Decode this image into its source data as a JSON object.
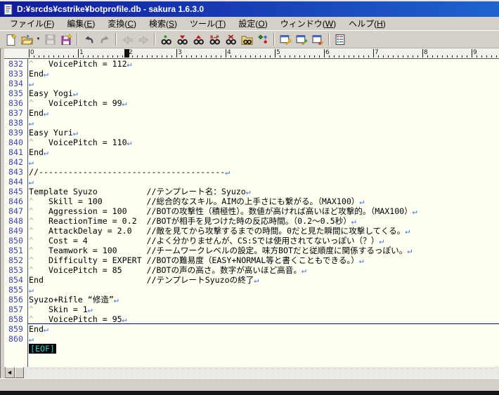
{
  "window": {
    "title": "D:¥srcds¥cstrike¥botprofile.db - sakura 1.6.3.0",
    "app_icon": "sakura-document-icon"
  },
  "menu": {
    "items": [
      {
        "label": "ファイル",
        "key": "F"
      },
      {
        "label": "編集",
        "key": "E"
      },
      {
        "label": "変換",
        "key": "C"
      },
      {
        "label": "検索",
        "key": "S"
      },
      {
        "label": "ツール",
        "key": "T"
      },
      {
        "label": "設定",
        "key": "O"
      },
      {
        "label": "ウィンドウ",
        "key": "W"
      },
      {
        "label": "ヘルプ",
        "key": "H"
      }
    ]
  },
  "toolbar": {
    "buttons": [
      {
        "name": "new-file",
        "icon": "new-file-icon",
        "enabled": true
      },
      {
        "name": "open-file",
        "icon": "open-folder-icon",
        "enabled": true,
        "dropdown": true
      },
      {
        "name": "save",
        "icon": "save-floppy-icon",
        "enabled": false
      },
      {
        "name": "save-as",
        "icon": "save-as-floppy-icon",
        "enabled": true
      },
      {
        "sep": true
      },
      {
        "name": "undo",
        "icon": "undo-arrow-icon",
        "enabled": true
      },
      {
        "name": "redo",
        "icon": "redo-arrow-icon",
        "enabled": false
      },
      {
        "sep": true
      },
      {
        "name": "jump-back",
        "icon": "jump-back-icon",
        "enabled": false
      },
      {
        "name": "jump-forward",
        "icon": "jump-forward-icon",
        "enabled": false
      },
      {
        "sep": true
      },
      {
        "name": "find",
        "icon": "find-binoculars-icon",
        "enabled": true
      },
      {
        "name": "find-next",
        "icon": "find-next-icon",
        "enabled": true
      },
      {
        "name": "find-prev",
        "icon": "find-prev-icon",
        "enabled": true
      },
      {
        "name": "replace",
        "icon": "replace-icon",
        "enabled": true
      },
      {
        "name": "clear-search",
        "icon": "clear-search-icon",
        "enabled": true
      },
      {
        "name": "grep",
        "icon": "grep-folder-icon",
        "enabled": true
      },
      {
        "name": "tag-jump",
        "icon": "tag-jump-icon",
        "enabled": true
      },
      {
        "sep": true
      },
      {
        "name": "type-settings",
        "icon": "type-settings-icon",
        "enabled": true
      },
      {
        "name": "common-settings",
        "icon": "common-settings-icon",
        "enabled": true
      },
      {
        "name": "keyword-settings",
        "icon": "keyword-settings-icon",
        "enabled": true
      },
      {
        "sep": true
      },
      {
        "name": "outline",
        "icon": "outline-icon",
        "enabled": true
      }
    ]
  },
  "ruler": {
    "cursor_col": 20,
    "columns_per_number": 10,
    "numbers": [
      "0",
      "1",
      "2",
      "3",
      "4",
      "5",
      "6",
      "7",
      "8",
      "9"
    ]
  },
  "editor": {
    "current_line": 858,
    "eof_label": "[EOF]",
    "lines": [
      {
        "n": 832,
        "tab": true,
        "text": "VoicePitch = 112",
        "ret": true
      },
      {
        "n": 833,
        "tab": false,
        "text": "End",
        "ret": true
      },
      {
        "n": 834,
        "tab": false,
        "text": "",
        "ret": true
      },
      {
        "n": 835,
        "tab": false,
        "text": "Easy Yogi",
        "ret": true
      },
      {
        "n": 836,
        "tab": true,
        "text": "VoicePitch = 99",
        "ret": true
      },
      {
        "n": 837,
        "tab": false,
        "text": "End",
        "ret": true
      },
      {
        "n": 838,
        "tab": false,
        "text": "",
        "ret": true
      },
      {
        "n": 839,
        "tab": false,
        "text": "Easy Yuri",
        "ret": true
      },
      {
        "n": 840,
        "tab": true,
        "text": "VoicePitch = 110",
        "ret": true
      },
      {
        "n": 841,
        "tab": false,
        "text": "End",
        "ret": true
      },
      {
        "n": 842,
        "tab": false,
        "text": "",
        "ret": true
      },
      {
        "n": 843,
        "tab": false,
        "text": "//--------------------------------------",
        "ret": true
      },
      {
        "n": 844,
        "tab": false,
        "text": "",
        "ret": true
      },
      {
        "n": 845,
        "tab": false,
        "text": "Template Syuzo          //テンプレート名：Syuzo",
        "ret": true
      },
      {
        "n": 846,
        "tab": true,
        "text": "Skill = 100         //総合的なスキル。AIMの上手さにも繋がる。（MAX100）",
        "ret": true
      },
      {
        "n": 847,
        "tab": true,
        "text": "Aggression = 100    //BOTの攻撃性（積極性）。数値が高ければ高いほど攻撃的。（MAX100）",
        "ret": true
      },
      {
        "n": 848,
        "tab": true,
        "text": "ReactionTime = 0.2  //BOTが相手を見つけた時の反応時間。（0.2～0.5秒）",
        "ret": true
      },
      {
        "n": 849,
        "tab": true,
        "text": "AttackDelay = 2.0   //敵を見てから攻撃するまでの時間。0だと見た瞬間に攻撃してくる。",
        "ret": true
      },
      {
        "n": 850,
        "tab": true,
        "text": "Cost = 4            //よく分かりませんが、CS:Sでは使用されてないっぽい（？）",
        "ret": true
      },
      {
        "n": 851,
        "tab": true,
        "text": "Teamwork = 100      //チームワークレベルの設定。味方BOTだと従順度に関係するっぽい。",
        "ret": true
      },
      {
        "n": 852,
        "tab": true,
        "text": "Difficulty = EXPERT //BOTの難易度（EASY+NORMAL等と書くこともできる。）",
        "ret": true
      },
      {
        "n": 853,
        "tab": true,
        "text": "VoicePitch = 85     //BOTの声の高さ。数字が高いほど高音。",
        "ret": true
      },
      {
        "n": 854,
        "tab": false,
        "text": "End                     //テンプレートSyuzoの終了",
        "ret": true
      },
      {
        "n": 855,
        "tab": false,
        "text": "",
        "ret": true
      },
      {
        "n": 856,
        "tab": false,
        "text": "Syuzo+Rifle “修造”",
        "ret": true
      },
      {
        "n": 857,
        "tab": true,
        "text": "Skin = 1",
        "ret": true
      },
      {
        "n": 858,
        "tab": true,
        "text": "VoicePitch = 95",
        "ret": true
      },
      {
        "n": 859,
        "tab": false,
        "text": "End",
        "ret": true
      },
      {
        "n": 860,
        "tab": false,
        "text": "",
        "ret": true
      }
    ]
  },
  "scrollbar": {
    "left_arrow": "◀"
  },
  "colors": {
    "titlebar_left": "#111b9e",
    "titlebar_right": "#1f63cf",
    "editor_bg": "#fffff2",
    "line_number": "#3a44c0",
    "return_mark": "#2e6be6",
    "tab_mark": "#aeaca4",
    "current_line_underline": "#0008b0",
    "eof_fg": "#2fd0d0",
    "eof_bg": "#000000"
  }
}
